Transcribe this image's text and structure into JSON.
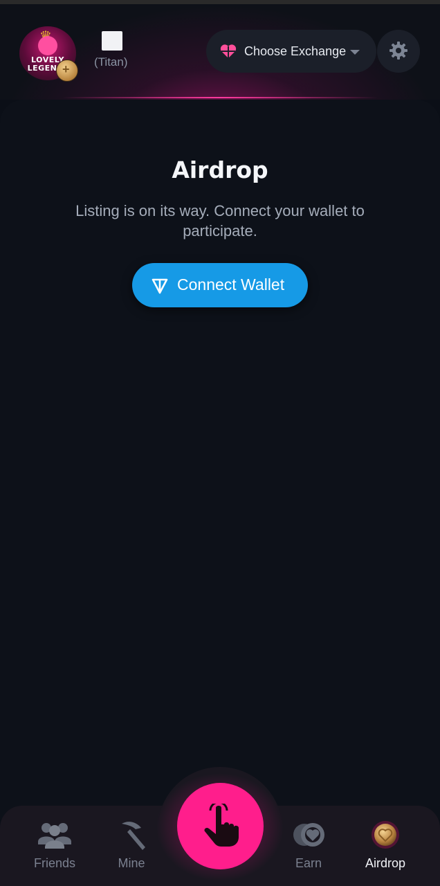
{
  "header": {
    "avatar_text_line1": "LOVELY",
    "avatar_text_line2": "LEGEN",
    "user_rank": "(Titan)",
    "exchange_label": "Choose Exchange"
  },
  "main": {
    "title": "Airdrop",
    "subtitle": "Listing is on its way. Connect your wallet to participate.",
    "connect_label": "Connect Wallet"
  },
  "nav": {
    "items": [
      {
        "label": "Friends",
        "icon": "friends-icon"
      },
      {
        "label": "Mine",
        "icon": "pickaxe-icon"
      },
      {
        "label": "Earn",
        "icon": "coins-icon"
      },
      {
        "label": "Airdrop",
        "icon": "coin-icon"
      }
    ]
  },
  "colors": {
    "accent": "#ff1e8c",
    "button_blue": "#169ae6",
    "background": "#0b0f17"
  }
}
